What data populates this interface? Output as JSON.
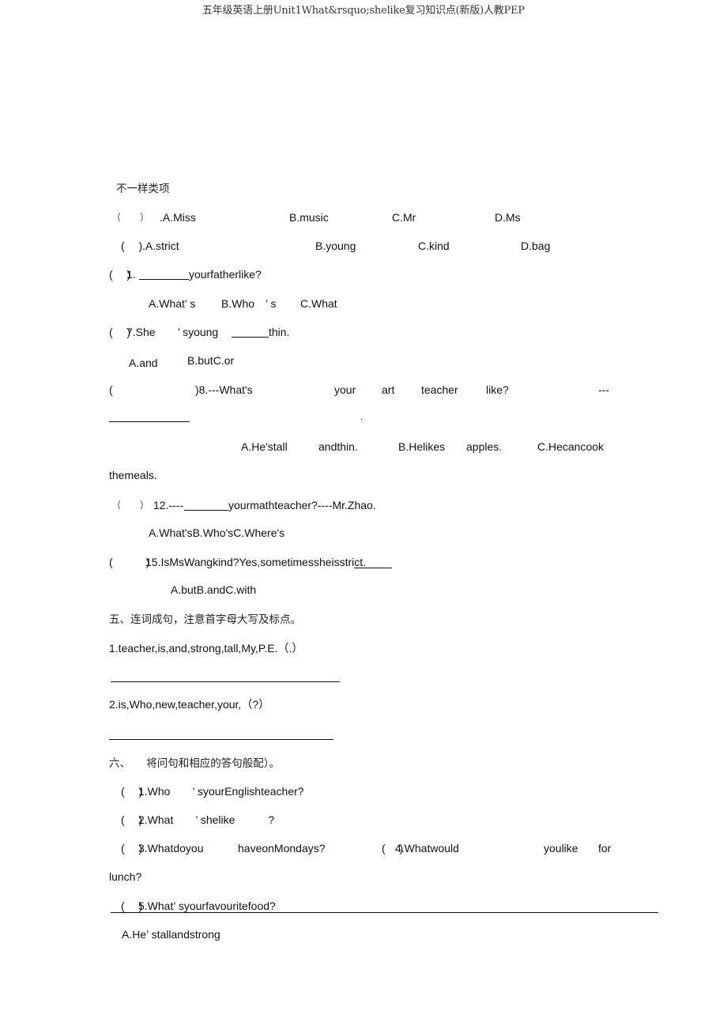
{
  "header": {
    "title": "五年级英语上册Unit1What&rsquo;shelike复习知识点(新版)人教PEP"
  },
  "section_odd_one_out": {
    "title": "不一样类项",
    "q1": {
      "paren": "（　　）",
      "a": ".A.Miss",
      "b": "B.music",
      "c": "C.Mr",
      "d": "D.Ms"
    },
    "q2": {
      "paren": "(　 )",
      "a": ".A.strict",
      "b": "B.young",
      "c": "C.kind",
      "d": "D.bag"
    }
  },
  "section_choice": {
    "q1": {
      "paren": "(　 )",
      "stem_pre": "1.",
      "stem_post": "yourfatherlike?",
      "options": [
        "A.What’ s",
        "B.Who　’ s",
        "C.What"
      ]
    },
    "q7": {
      "paren": "(　 )",
      "stem_pre": "7.She　　’ syoung",
      "stem_post": "thin.",
      "options": [
        "A.and",
        "B.butC.or"
      ]
    },
    "q8": {
      "paren": "(",
      "paren_close": ")8.---What's",
      "words": [
        "your",
        "art",
        "teacher",
        "like?",
        "---"
      ],
      "dot": ".",
      "options": [
        "A.He'stall",
        "andthin.",
        "B.Helikes",
        "apples.",
        "C.Hecancook"
      ],
      "continuation": "themeals."
    },
    "q12": {
      "paren": "（　　）",
      "stem_pre": "12.----",
      "stem_post": "yourmathteacher?----Mr.Zhao.",
      "options": "A.What'sB.Who'sC.Where's"
    },
    "q15": {
      "paren": "(　　　)",
      "stem": "15.IsMsWangkind?Yes,sometimessheisstrict.",
      "options": "A.butB.andC.with"
    }
  },
  "section_five": {
    "title": "五、连词成句，注意首字母大写及标点。",
    "items": [
      "1.teacher,is,and,strong,tall,My,P.E.（.）",
      "2.is,Who,new,teacher,your,（?）"
    ]
  },
  "section_six": {
    "title": "六、　　将问句和相应的答句般配）。",
    "items": [
      {
        "paren": "(　 )",
        "text": "1.Who　　’ syourEnglishteacher?"
      },
      {
        "paren": "(　 )",
        "text": "2.What　　’ shelike　　　?"
      },
      {
        "paren": "(　 )",
        "text": "3.Whatdoyou",
        "text2": "haveonMondays?"
      },
      {
        "paren": "(　 )",
        "text": "4.Whatwould",
        "text2": "youlike",
        "text3": "for",
        "continuation": "lunch?"
      },
      {
        "paren": "(　 )",
        "text": "5.What’ syourfavouritefood?"
      }
    ],
    "answers": [
      "A.He’ stallandstrong"
    ]
  }
}
